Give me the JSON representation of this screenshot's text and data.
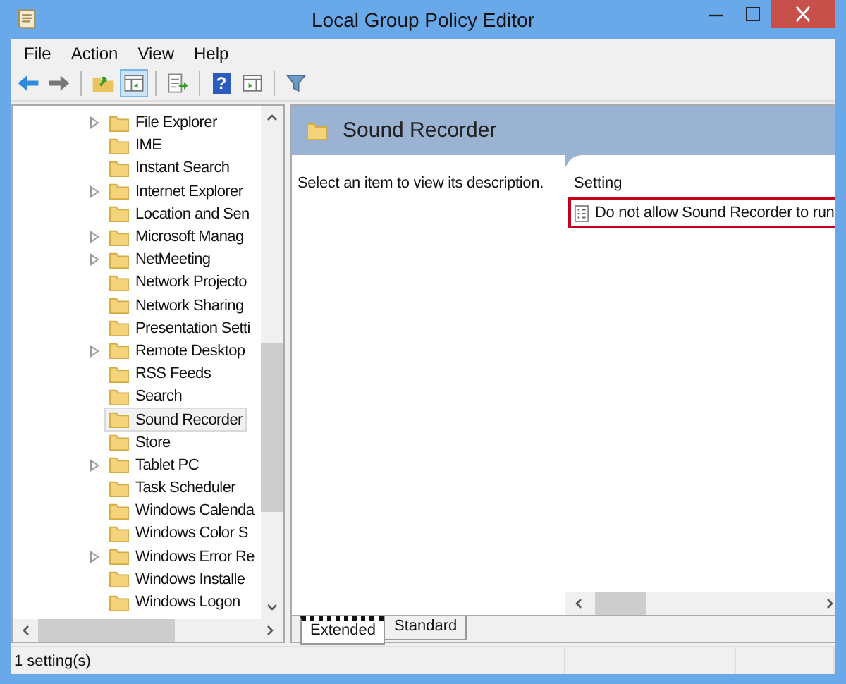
{
  "window": {
    "title": "Local Group Policy Editor"
  },
  "menu": [
    "File",
    "Action",
    "View",
    "Help"
  ],
  "toolbar": [
    {
      "kind": "back",
      "pressed": false
    },
    {
      "kind": "forward",
      "pressed": false
    },
    {
      "kind": "sep"
    },
    {
      "kind": "up",
      "pressed": false
    },
    {
      "kind": "tree",
      "pressed": true
    },
    {
      "kind": "sep"
    },
    {
      "kind": "export",
      "pressed": false
    },
    {
      "kind": "sep"
    },
    {
      "kind": "help",
      "pressed": false,
      "label": "?"
    },
    {
      "kind": "pane",
      "pressed": false
    },
    {
      "kind": "sep"
    },
    {
      "kind": "filter",
      "pressed": false
    }
  ],
  "tree": [
    {
      "label": "File Explorer",
      "expandable": true,
      "selected": false
    },
    {
      "label": "IME",
      "expandable": false,
      "selected": false
    },
    {
      "label": "Instant Search",
      "expandable": false,
      "selected": false
    },
    {
      "label": "Internet Explorer",
      "expandable": true,
      "selected": false
    },
    {
      "label": "Location and Sen",
      "expandable": false,
      "selected": false
    },
    {
      "label": "Microsoft Manag",
      "expandable": true,
      "selected": false
    },
    {
      "label": "NetMeeting",
      "expandable": true,
      "selected": false
    },
    {
      "label": "Network Projecto",
      "expandable": false,
      "selected": false
    },
    {
      "label": "Network Sharing",
      "expandable": false,
      "selected": false
    },
    {
      "label": "Presentation Setti",
      "expandable": false,
      "selected": false
    },
    {
      "label": "Remote Desktop",
      "expandable": true,
      "selected": false
    },
    {
      "label": "RSS Feeds",
      "expandable": false,
      "selected": false
    },
    {
      "label": "Search",
      "expandable": false,
      "selected": false
    },
    {
      "label": "Sound Recorder",
      "expandable": false,
      "selected": true
    },
    {
      "label": "Store",
      "expandable": false,
      "selected": false
    },
    {
      "label": "Tablet PC",
      "expandable": true,
      "selected": false
    },
    {
      "label": "Task Scheduler",
      "expandable": false,
      "selected": false
    },
    {
      "label": "Windows Calenda",
      "expandable": false,
      "selected": false
    },
    {
      "label": "Windows Color S",
      "expandable": false,
      "selected": false
    },
    {
      "label": "Windows Error Re",
      "expandable": true,
      "selected": false
    },
    {
      "label": "Windows Installe",
      "expandable": false,
      "selected": false
    },
    {
      "label": "Windows Logon",
      "expandable": false,
      "selected": false
    }
  ],
  "header": {
    "title": "Sound Recorder"
  },
  "description": "Select an item to view its description.",
  "settings": {
    "column": "Setting",
    "rows": [
      {
        "label": "Do not allow Sound Recorder to run",
        "highlighted": true
      }
    ]
  },
  "tabs": [
    {
      "label": "Extended",
      "selected": true
    },
    {
      "label": "Standard",
      "selected": false
    }
  ],
  "status_bar": "1 setting(s)"
}
